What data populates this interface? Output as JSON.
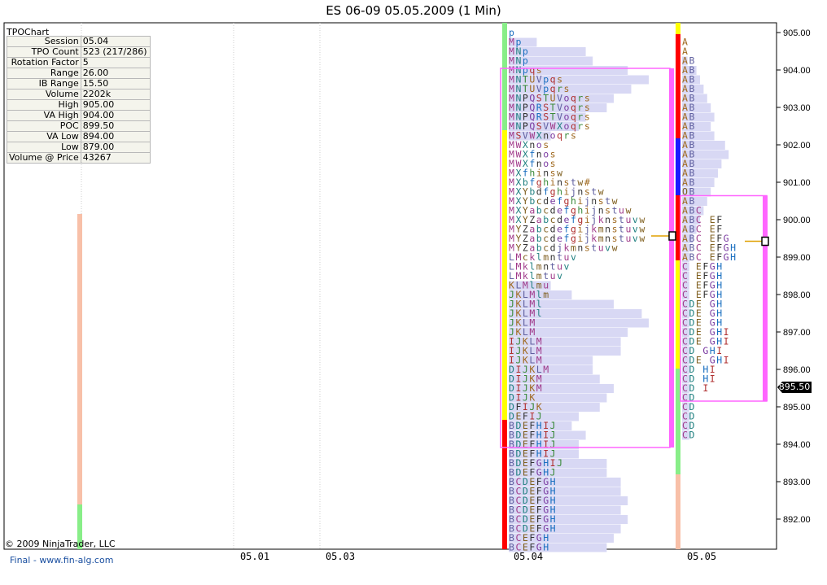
{
  "title": "ES 06-09  05.05.2009 (1 Min)",
  "info_panel": {
    "header": "TPOChart",
    "rows": [
      {
        "label": "Session",
        "value": "05.04"
      },
      {
        "label": "TPO Count",
        "value": "523 (217/286)"
      },
      {
        "label": "Rotation Factor",
        "value": "5"
      },
      {
        "label": "Range",
        "value": "26.00"
      },
      {
        "label": "IB Range",
        "value": "15.50"
      },
      {
        "label": "Volume",
        "value": "2202k"
      },
      {
        "label": "High",
        "value": "905.00"
      },
      {
        "label": "VA High",
        "value": "904.00"
      },
      {
        "label": "POC",
        "value": "899.50"
      },
      {
        "label": "VA Low",
        "value": "894.00"
      },
      {
        "label": "Low",
        "value": "879.00"
      },
      {
        "label": "Volume @ Price",
        "value": "43267"
      }
    ]
  },
  "copyright": "© 2009 NinjaTrader, LLC",
  "footer_link": "Final - www.fin-alg.com",
  "current_price_label": "895.50",
  "colors": {
    "up": "#1a1aff",
    "down": "#ff0000",
    "neutral": "#ffff00",
    "va_box": "#ff66ff",
    "profile_bar": "#d8d8f4",
    "light_red": "#f8c0a8",
    "light_green": "#88ee88"
  },
  "chart_data": {
    "type": "tpo-profile",
    "title": "ES 06-09  05.05.2009 (1 Min)",
    "y_axis": {
      "ticks": [
        "905.00",
        "904.00",
        "903.00",
        "902.00",
        "901.00",
        "900.00",
        "899.00",
        "898.00",
        "897.00",
        "896.00",
        "895.00",
        "894.00",
        "893.00",
        "892.00"
      ],
      "ylim": [
        891.25,
        905.25
      ],
      "step": 0.25
    },
    "x_axis": {
      "ticks": [
        "05.01",
        "05.03",
        "05.04",
        "05.05"
      ]
    },
    "sessions": [
      {
        "session": "05.04",
        "poc": 899.5,
        "va_high": 904.0,
        "va_low": 894.0,
        "rows": [
          {
            "price": 905.0,
            "tpo": "p",
            "volume": 0
          },
          {
            "price": 904.75,
            "tpo": "Mp",
            "volume": 8
          },
          {
            "price": 904.5,
            "tpo": "MNp",
            "volume": 22
          },
          {
            "price": 904.25,
            "tpo": "MNp",
            "volume": 24
          },
          {
            "price": 904.0,
            "tpo": "MNpqs",
            "volume": 34
          },
          {
            "price": 903.75,
            "tpo": "MNTUVpqs",
            "volume": 40
          },
          {
            "price": 903.5,
            "tpo": "MNTUVpqrs",
            "volume": 35
          },
          {
            "price": 903.25,
            "tpo": "MNPQSTUVoqrs",
            "volume": 30
          },
          {
            "price": 903.0,
            "tpo": "MNPQRSTVoqrs",
            "volume": 28
          },
          {
            "price": 902.75,
            "tpo": "MNPQRSTVoqrs",
            "volume": 22
          },
          {
            "price": 902.5,
            "tpo": "MNPQSVWXoqrs",
            "volume": 20
          },
          {
            "price": 902.25,
            "tpo": "MSVWXnoqrs",
            "volume": 12
          },
          {
            "price": 902.0,
            "tpo": "MWXnos",
            "volume": 0
          },
          {
            "price": 901.75,
            "tpo": "MWXfnos",
            "volume": 0
          },
          {
            "price": 901.5,
            "tpo": "MWXfnos",
            "volume": 0
          },
          {
            "price": 901.25,
            "tpo": "MXfhinsw",
            "volume": 0
          },
          {
            "price": 901.0,
            "tpo": "MXbfghinstw#",
            "volume": 0
          },
          {
            "price": 900.75,
            "tpo": "MXYbdfghijnstw",
            "volume": 0
          },
          {
            "price": 900.5,
            "tpo": "MXYbcdefghijnstw",
            "volume": 0
          },
          {
            "price": 900.25,
            "tpo": "MXYabcdefghijnstuw",
            "volume": 0
          },
          {
            "price": 900.0,
            "tpo": "MXYZabcdefgijknstuvw",
            "volume": 0
          },
          {
            "price": 899.75,
            "tpo": "MYZabcdefgijkmnstuvw",
            "volume": 0
          },
          {
            "price": 899.5,
            "tpo": "MYZabcdefgijkmnstuvw",
            "volume": 0
          },
          {
            "price": 899.25,
            "tpo": "MYZabcdjkmnstuvw",
            "volume": 0
          },
          {
            "price": 899.0,
            "tpo": "LMcklmntuv",
            "volume": 0
          },
          {
            "price": 898.75,
            "tpo": "LMklmntuv",
            "volume": 0
          },
          {
            "price": 898.5,
            "tpo": "LMklmtuv",
            "volume": 0
          },
          {
            "price": 898.25,
            "tpo": "KLMlmu",
            "volume": 12
          },
          {
            "price": 898.0,
            "tpo": "JKLMlm",
            "volume": 18
          },
          {
            "price": 897.75,
            "tpo": "JKLMl",
            "volume": 30
          },
          {
            "price": 897.5,
            "tpo": "JKLMl",
            "volume": 38
          },
          {
            "price": 897.25,
            "tpo": "JKLM",
            "volume": 40
          },
          {
            "price": 897.0,
            "tpo": "JKLM",
            "volume": 34
          },
          {
            "price": 896.75,
            "tpo": "IJKLM",
            "volume": 32
          },
          {
            "price": 896.5,
            "tpo": "IJKLM",
            "volume": 32
          },
          {
            "price": 896.25,
            "tpo": "IJKLM",
            "volume": 24
          },
          {
            "price": 896.0,
            "tpo": "DIJKLM",
            "volume": 24
          },
          {
            "price": 895.75,
            "tpo": "DIJKM",
            "volume": 26
          },
          {
            "price": 895.5,
            "tpo": "DIJKM",
            "volume": 30
          },
          {
            "price": 895.25,
            "tpo": "DIJK",
            "volume": 28
          },
          {
            "price": 895.0,
            "tpo": "DFIJK",
            "volume": 26
          },
          {
            "price": 894.75,
            "tpo": "DEFIJ",
            "volume": 20
          },
          {
            "price": 894.5,
            "tpo": "BDEFHIJ",
            "volume": 18
          },
          {
            "price": 894.25,
            "tpo": "BDEFHIJ",
            "volume": 22
          },
          {
            "price": 894.0,
            "tpo": "BDEFHIJ",
            "volume": 20
          },
          {
            "price": 893.75,
            "tpo": "BDEFHIJ",
            "volume": 20
          },
          {
            "price": 893.5,
            "tpo": "BDEFGHIJ",
            "volume": 28
          },
          {
            "price": 893.25,
            "tpo": "BDEFGHJ",
            "volume": 28
          },
          {
            "price": 893.0,
            "tpo": "BCDEFGH",
            "volume": 32
          },
          {
            "price": 892.75,
            "tpo": "BCDEFGH",
            "volume": 32
          },
          {
            "price": 892.5,
            "tpo": "BCDEFGH",
            "volume": 34
          },
          {
            "price": 892.25,
            "tpo": "BCDEFGH",
            "volume": 32
          },
          {
            "price": 892.0,
            "tpo": "BCDEFGH",
            "volume": 34
          },
          {
            "price": 891.75,
            "tpo": "BCDEFGH",
            "volume": 32
          },
          {
            "price": 891.5,
            "tpo": "BCEFGH",
            "volume": 30
          },
          {
            "price": 891.25,
            "tpo": "BCEFGH",
            "volume": 28
          }
        ]
      },
      {
        "session": "05.05",
        "poc": 899.25,
        "va_high": 900.25,
        "va_low": 895.0,
        "rows": [
          {
            "price": 904.75,
            "tpo": "A",
            "volume": 0
          },
          {
            "price": 904.5,
            "tpo": "A",
            "volume": 0
          },
          {
            "price": 904.25,
            "tpo": "AB",
            "volume": 3
          },
          {
            "price": 904.0,
            "tpo": "AB",
            "volume": 8
          },
          {
            "price": 903.75,
            "tpo": "AB",
            "volume": 10
          },
          {
            "price": 903.5,
            "tpo": "AB",
            "volume": 12
          },
          {
            "price": 903.25,
            "tpo": "AB",
            "volume": 14
          },
          {
            "price": 903.0,
            "tpo": "AB",
            "volume": 16
          },
          {
            "price": 902.75,
            "tpo": "AB",
            "volume": 18
          },
          {
            "price": 902.5,
            "tpo": "AB",
            "volume": 16
          },
          {
            "price": 902.25,
            "tpo": "AB",
            "volume": 18
          },
          {
            "price": 902.0,
            "tpo": "AB",
            "volume": 24
          },
          {
            "price": 901.75,
            "tpo": "AB",
            "volume": 26
          },
          {
            "price": 901.5,
            "tpo": "AB",
            "volume": 22
          },
          {
            "price": 901.25,
            "tpo": "AB",
            "volume": 20
          },
          {
            "price": 901.0,
            "tpo": "AB",
            "volume": 18
          },
          {
            "price": 900.75,
            "tpo": "OB",
            "volume": 16
          },
          {
            "price": 900.5,
            "tpo": "AB",
            "volume": 14
          },
          {
            "price": 900.25,
            "tpo": "ABC",
            "volume": 12
          },
          {
            "price": 900.0,
            "tpo": "ABC EF",
            "volume": 10
          },
          {
            "price": 899.75,
            "tpo": "ABC EF",
            "volume": 8
          },
          {
            "price": 899.5,
            "tpo": "ABC EFG",
            "volume": 6
          },
          {
            "price": 899.25,
            "tpo": "ABC EFGH",
            "volume": 4
          },
          {
            "price": 899.0,
            "tpo": "ABC EFGH",
            "volume": 4
          },
          {
            "price": 898.75,
            "tpo": " C EFGH",
            "volume": 4
          },
          {
            "price": 898.5,
            "tpo": " C EFGH",
            "volume": 4
          },
          {
            "price": 898.25,
            "tpo": " C EFGH",
            "volume": 4
          },
          {
            "price": 898.0,
            "tpo": " C EFGH",
            "volume": 4
          },
          {
            "price": 897.75,
            "tpo": " CDE GH",
            "volume": 4
          },
          {
            "price": 897.5,
            "tpo": " CDE GH",
            "volume": 4
          },
          {
            "price": 897.25,
            "tpo": " CDE GH",
            "volume": 4
          },
          {
            "price": 897.0,
            "tpo": " CDE GHI",
            "volume": 4
          },
          {
            "price": 896.75,
            "tpo": " CDE GHI",
            "volume": 4
          },
          {
            "price": 896.5,
            "tpo": " CD  GHI",
            "volume": 4
          },
          {
            "price": 896.25,
            "tpo": " CDE GHI",
            "volume": 4
          },
          {
            "price": 896.0,
            "tpo": " CD   HI",
            "volume": 4
          },
          {
            "price": 895.75,
            "tpo": " CD   HI",
            "volume": 4
          },
          {
            "price": 895.5,
            "tpo": " CD    I",
            "volume": 4
          },
          {
            "price": 895.25,
            "tpo": " CD",
            "volume": 4
          },
          {
            "price": 895.0,
            "tpo": " CD",
            "volume": 4
          },
          {
            "price": 894.75,
            "tpo": " CD",
            "volume": 4
          },
          {
            "price": 894.5,
            "tpo": " CD",
            "volume": 4
          },
          {
            "price": 894.25,
            "tpo": " CD",
            "volume": 4
          }
        ]
      }
    ]
  }
}
